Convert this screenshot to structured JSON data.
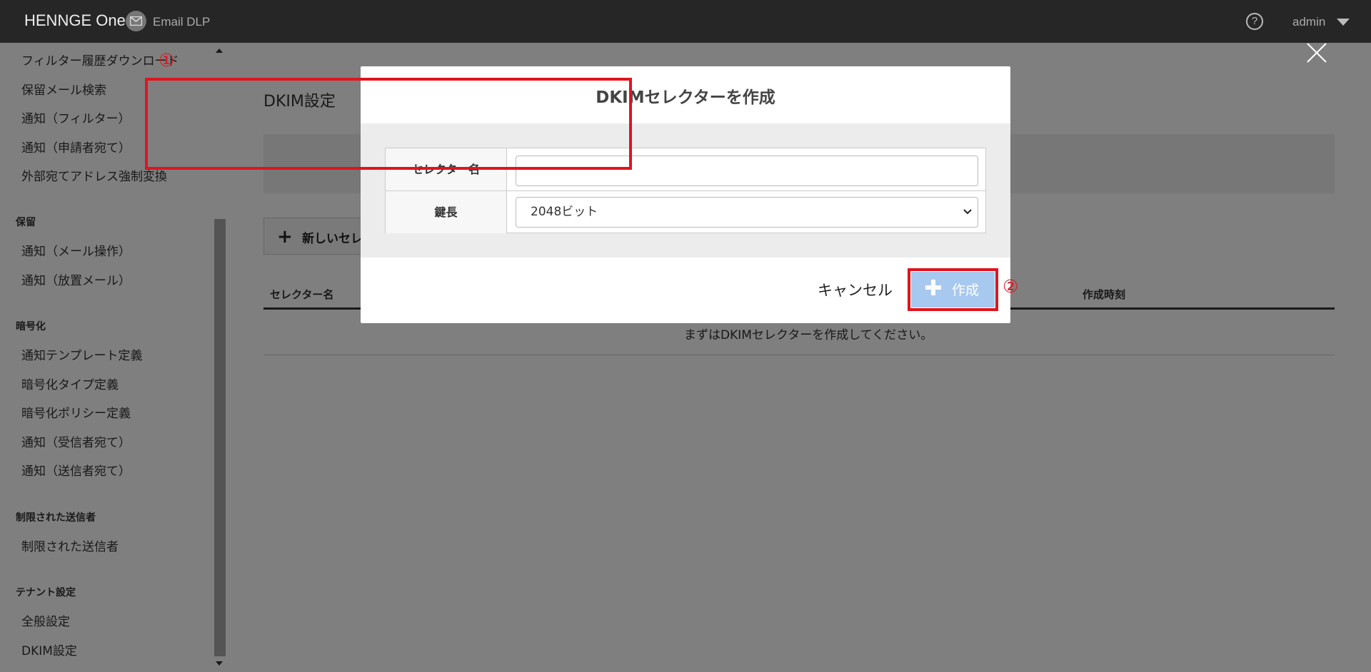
{
  "header": {
    "logo": "HENNGE One",
    "product": "Email DLP",
    "help_label": "?",
    "user": "admin"
  },
  "sidebar": {
    "items_top": [
      "フィルター履歴ダウンロード",
      "保留メール検索",
      "通知（フィルター）",
      "通知（申請者宛て）",
      "外部宛てアドレス強制変換"
    ],
    "section_hold": "保留",
    "items_hold": [
      "通知（メール操作）",
      "通知（放置メール）"
    ],
    "section_encrypt": "暗号化",
    "items_encrypt": [
      "通知テンプレート定義",
      "暗号化タイプ定義",
      "暗号化ポリシー定義",
      "通知（受信者宛て）",
      "通知（送信者宛て）"
    ],
    "section_restricted": "制限された送信者",
    "items_restricted": [
      "制限された送信者"
    ],
    "section_tenant": "テナント設定",
    "items_tenant": [
      "全般設定",
      "DKIM設定"
    ]
  },
  "main": {
    "title": "DKIM設定",
    "new_button": "新しいセレ",
    "col_selector": "セレクター名",
    "col_created": "作成時刻",
    "empty_message": "まずはDKIMセレクターを作成してください。"
  },
  "modal": {
    "title": "DKIMセレクターを作成",
    "selector_label": "セレクター名",
    "selector_value": "",
    "key_length_label": "鍵長",
    "key_length_value": "2048ビット",
    "cancel": "キャンセル",
    "create": "作成",
    "annotation_1": "①",
    "annotation_2": "②"
  },
  "colors": {
    "header_bg": "#262626",
    "annotation_red": "#e0141e",
    "create_button": "#a8c9ef"
  }
}
